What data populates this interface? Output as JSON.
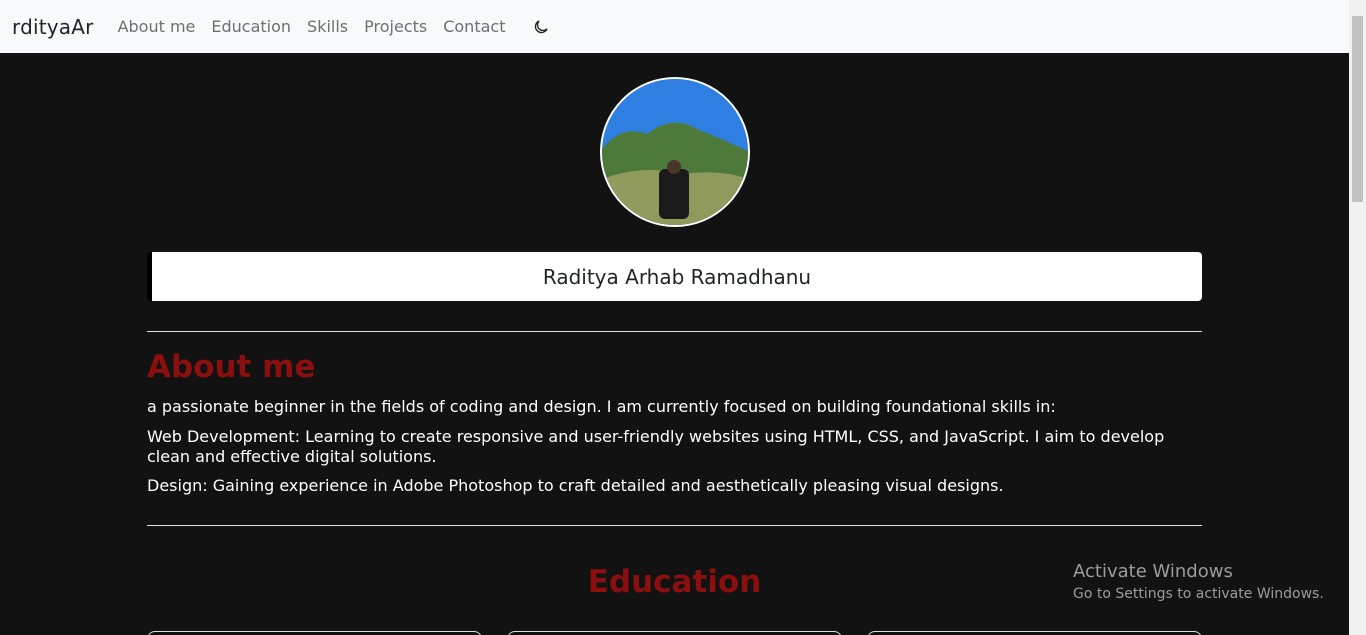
{
  "navbar": {
    "brand": "rdityaAr",
    "links": [
      "About me",
      "Education",
      "Skills",
      "Projects",
      "Contact"
    ],
    "theme_toggle_icon": "moon-icon"
  },
  "profile": {
    "name": "Raditya Arhab Ramadhanu"
  },
  "about": {
    "title": "About me",
    "paragraphs": [
      "a passionate beginner in the fields of coding and design. I am currently focused on building foundational skills in:",
      "Web Development: Learning to create responsive and user-friendly websites using HTML, CSS, and JavaScript. I aim to develop clean and effective digital solutions.",
      "Design: Gaining experience in Adobe Photoshop to craft detailed and aesthetically pleasing visual designs."
    ]
  },
  "education": {
    "title": "Education"
  },
  "watermark": {
    "title": "Activate Windows",
    "subtitle": "Go to Settings to activate Windows."
  },
  "colors": {
    "accent": "#8b0f0f",
    "background": "#121212",
    "navbar": "#f8f9fa"
  }
}
